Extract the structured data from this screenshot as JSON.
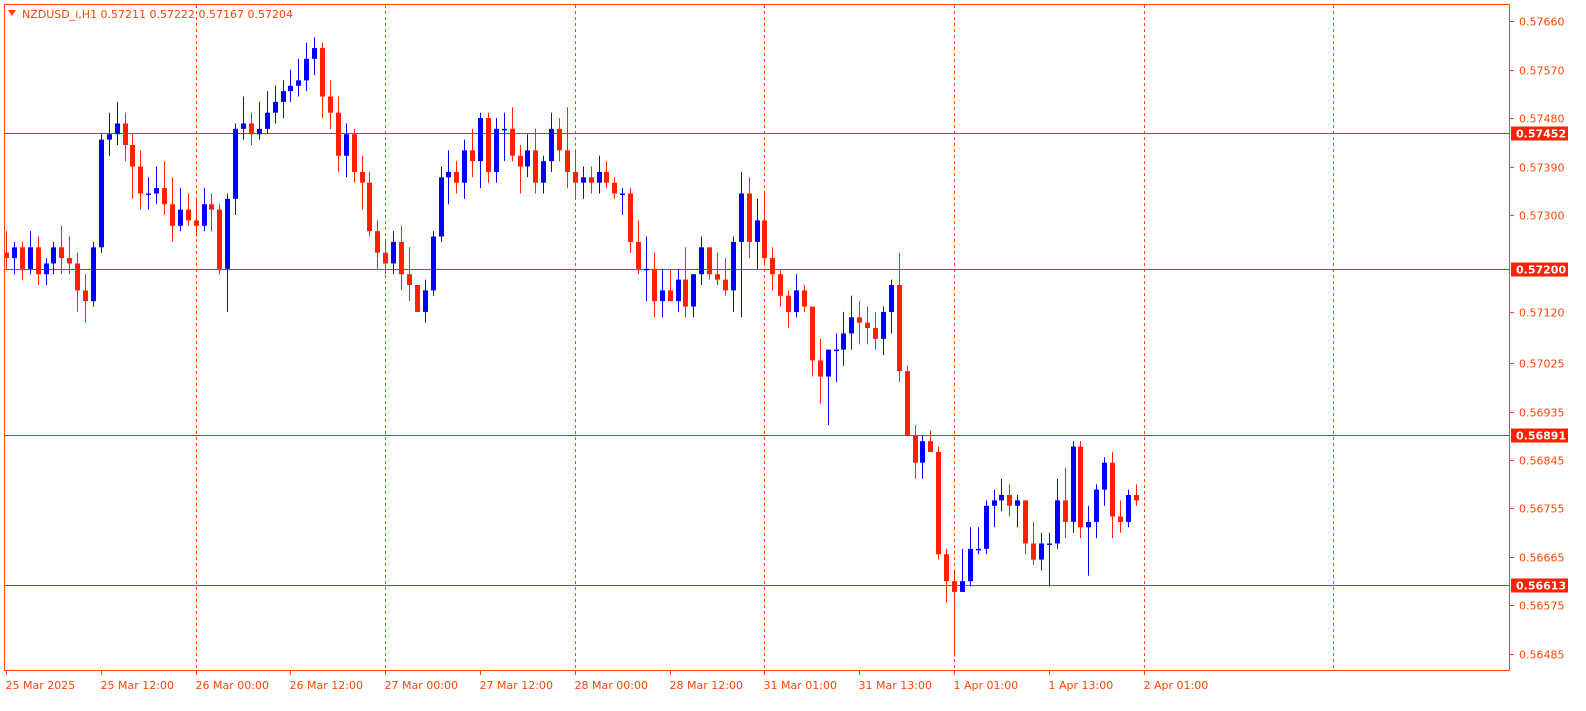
{
  "symbol_header": {
    "text": "NZDUSD_i,H1  0.57211  0.57222  0.57167  0.57204",
    "indicator_icon": "triangle-down-icon"
  },
  "colors": {
    "background": "#ffffff",
    "frame": "#ff4500",
    "grid": "#ff4500",
    "text": "#ff4500",
    "bull": "#0000ff",
    "bear": "#ff2000",
    "level_line": "#ff2000",
    "level_tag_bg": "#ff2000",
    "level_tag_text": "#ffffff"
  },
  "chart_data": {
    "type": "candlestick",
    "symbol": "NZDUSD_i",
    "timeframe": "H1",
    "last_bar": {
      "open": 0.57211,
      "high": 0.57222,
      "low": 0.57167,
      "close": 0.57204
    },
    "ylim": [
      0.56455,
      0.5769
    ],
    "price_ticks": [
      0.5766,
      0.5757,
      0.5748,
      0.5739,
      0.573,
      0.5712,
      0.57025,
      0.56935,
      0.56845,
      0.56755,
      0.56665,
      0.56575,
      0.56485
    ],
    "price_tick_labels": [
      "0.57660",
      "0.57570",
      "0.57480",
      "0.57390",
      "0.57300",
      "0.57120",
      "0.57025",
      "0.56935",
      "0.56845",
      "0.56755",
      "0.56665",
      "0.56575",
      "0.56485"
    ],
    "horizontal_levels": [
      {
        "price": 0.57452,
        "label": "0.57452"
      },
      {
        "price": 0.572,
        "label": "0.57200"
      },
      {
        "price": 0.56891,
        "label": "0.56891"
      },
      {
        "price": 0.56613,
        "label": "0.56613"
      }
    ],
    "time_labels": [
      "25 Mar 2025",
      "25 Mar 12:00",
      "26 Mar 00:00",
      "26 Mar 12:00",
      "27 Mar 00:00",
      "27 Mar 12:00",
      "28 Mar 00:00",
      "28 Mar 12:00",
      "31 Mar 01:00",
      "31 Mar 13:00",
      "1 Apr 01:00",
      "1 Apr 13:00",
      "2 Apr 01:00"
    ],
    "time_label_bar_index": [
      0,
      12,
      24,
      36,
      48,
      60,
      72,
      84,
      96,
      108,
      120,
      132,
      144
    ],
    "vertical_grid_bar_index": [
      24,
      48,
      72,
      96,
      120,
      144,
      168
    ],
    "grid": "vertical dotted",
    "ohlc": [
      [
        0.5723,
        0.5727,
        0.572,
        0.5722
      ],
      [
        0.5722,
        0.5725,
        0.5719,
        0.5724
      ],
      [
        0.5724,
        0.5725,
        0.5718,
        0.572
      ],
      [
        0.572,
        0.5727,
        0.5719,
        0.5724
      ],
      [
        0.5724,
        0.5726,
        0.5717,
        0.5719
      ],
      [
        0.5719,
        0.5722,
        0.5717,
        0.5721
      ],
      [
        0.5721,
        0.5725,
        0.5719,
        0.5724
      ],
      [
        0.5724,
        0.5728,
        0.5719,
        0.5722
      ],
      [
        0.5722,
        0.5726,
        0.5719,
        0.5721
      ],
      [
        0.5721,
        0.5723,
        0.5712,
        0.5716
      ],
      [
        0.5716,
        0.5719,
        0.571,
        0.5714
      ],
      [
        0.5714,
        0.5725,
        0.5713,
        0.5724
      ],
      [
        0.5724,
        0.5745,
        0.5723,
        0.5744
      ],
      [
        0.5744,
        0.5749,
        0.5741,
        0.5745
      ],
      [
        0.5745,
        0.5751,
        0.5743,
        0.5747
      ],
      [
        0.5747,
        0.5749,
        0.574,
        0.5743
      ],
      [
        0.5743,
        0.5745,
        0.5733,
        0.5739
      ],
      [
        0.5739,
        0.5742,
        0.5731,
        0.5734
      ],
      [
        0.5734,
        0.5737,
        0.5731,
        0.5734
      ],
      [
        0.5734,
        0.5739,
        0.5732,
        0.5735
      ],
      [
        0.5735,
        0.574,
        0.573,
        0.5732
      ],
      [
        0.5732,
        0.5737,
        0.5725,
        0.5728
      ],
      [
        0.5728,
        0.5735,
        0.5727,
        0.5731
      ],
      [
        0.5731,
        0.5734,
        0.5728,
        0.5729
      ],
      [
        0.5729,
        0.5733,
        0.5726,
        0.5728
      ],
      [
        0.5728,
        0.5735,
        0.5727,
        0.5732
      ],
      [
        0.5732,
        0.5734,
        0.5727,
        0.5731
      ],
      [
        0.5731,
        0.5732,
        0.5719,
        0.572
      ],
      [
        0.572,
        0.5734,
        0.5712,
        0.5733
      ],
      [
        0.5733,
        0.5747,
        0.573,
        0.5746
      ],
      [
        0.5746,
        0.5752,
        0.5744,
        0.5747
      ],
      [
        0.5747,
        0.5749,
        0.5743,
        0.5745
      ],
      [
        0.5745,
        0.5751,
        0.5744,
        0.5746
      ],
      [
        0.5746,
        0.5753,
        0.5745,
        0.5749
      ],
      [
        0.5749,
        0.5754,
        0.5747,
        0.5751
      ],
      [
        0.5751,
        0.5755,
        0.5748,
        0.5753
      ],
      [
        0.5753,
        0.5757,
        0.5751,
        0.5754
      ],
      [
        0.5754,
        0.5759,
        0.5752,
        0.5755
      ],
      [
        0.5755,
        0.5762,
        0.5753,
        0.5759
      ],
      [
        0.5759,
        0.5763,
        0.5756,
        0.5761
      ],
      [
        0.5761,
        0.5762,
        0.5748,
        0.5752
      ],
      [
        0.5752,
        0.5755,
        0.5746,
        0.5749
      ],
      [
        0.5749,
        0.5752,
        0.5738,
        0.5741
      ],
      [
        0.5741,
        0.5747,
        0.5737,
        0.5745
      ],
      [
        0.5745,
        0.5746,
        0.5736,
        0.5738
      ],
      [
        0.5738,
        0.5741,
        0.5731,
        0.5736
      ],
      [
        0.5736,
        0.5738,
        0.5726,
        0.5727
      ],
      [
        0.5727,
        0.5729,
        0.572,
        0.5723
      ],
      [
        0.5723,
        0.5725,
        0.5719,
        0.5721
      ],
      [
        0.5721,
        0.5727,
        0.5719,
        0.5725
      ],
      [
        0.5725,
        0.5728,
        0.5716,
        0.5719
      ],
      [
        0.5719,
        0.5724,
        0.5714,
        0.5717
      ],
      [
        0.5717,
        0.5715,
        0.5712,
        0.5712
      ],
      [
        0.5712,
        0.5718,
        0.571,
        0.5716
      ],
      [
        0.5716,
        0.5727,
        0.5715,
        0.5726
      ],
      [
        0.5726,
        0.5739,
        0.5725,
        0.5737
      ],
      [
        0.5737,
        0.5742,
        0.5732,
        0.5738
      ],
      [
        0.5738,
        0.574,
        0.5734,
        0.5736
      ],
      [
        0.5736,
        0.5744,
        0.5733,
        0.5742
      ],
      [
        0.5742,
        0.5746,
        0.5737,
        0.574
      ],
      [
        0.574,
        0.5749,
        0.5735,
        0.5748
      ],
      [
        0.5748,
        0.5749,
        0.5736,
        0.5738
      ],
      [
        0.5738,
        0.5748,
        0.5736,
        0.5746
      ],
      [
        0.5746,
        0.5749,
        0.574,
        0.5746
      ],
      [
        0.5746,
        0.575,
        0.574,
        0.5741
      ],
      [
        0.5741,
        0.5743,
        0.5734,
        0.5739
      ],
      [
        0.5739,
        0.5745,
        0.5737,
        0.5742
      ],
      [
        0.5742,
        0.5746,
        0.5734,
        0.5736
      ],
      [
        0.5736,
        0.5741,
        0.5734,
        0.574
      ],
      [
        0.574,
        0.5749,
        0.5738,
        0.5746
      ],
      [
        0.5746,
        0.5748,
        0.574,
        0.5742
      ],
      [
        0.5742,
        0.575,
        0.5735,
        0.5738
      ],
      [
        0.5738,
        0.5742,
        0.5733,
        0.5736
      ],
      [
        0.5736,
        0.5739,
        0.5733,
        0.5737
      ],
      [
        0.5737,
        0.5739,
        0.5734,
        0.5736
      ],
      [
        0.5736,
        0.5741,
        0.5734,
        0.5738
      ],
      [
        0.5738,
        0.574,
        0.5735,
        0.5736
      ],
      [
        0.5736,
        0.5737,
        0.5733,
        0.5734
      ],
      [
        0.5734,
        0.5735,
        0.573,
        0.5734
      ],
      [
        0.5734,
        0.5735,
        0.5723,
        0.5725
      ],
      [
        0.5725,
        0.5729,
        0.5719,
        0.572
      ],
      [
        0.572,
        0.5726,
        0.5714,
        0.572
      ],
      [
        0.572,
        0.5723,
        0.5711,
        0.5714
      ],
      [
        0.5714,
        0.572,
        0.5711,
        0.5716
      ],
      [
        0.5716,
        0.572,
        0.5714,
        0.5714
      ],
      [
        0.5714,
        0.572,
        0.5712,
        0.5718
      ],
      [
        0.5718,
        0.5724,
        0.5711,
        0.5713
      ],
      [
        0.5713,
        0.5719,
        0.5711,
        0.5719
      ],
      [
        0.5719,
        0.5726,
        0.5717,
        0.5724
      ],
      [
        0.5724,
        0.5723,
        0.5718,
        0.5719
      ],
      [
        0.5719,
        0.5723,
        0.5717,
        0.5718
      ],
      [
        0.5718,
        0.5722,
        0.5715,
        0.5716
      ],
      [
        0.5716,
        0.5726,
        0.5712,
        0.5725
      ],
      [
        0.5725,
        0.5738,
        0.5711,
        0.5734
      ],
      [
        0.5734,
        0.5737,
        0.5722,
        0.5725
      ],
      [
        0.5725,
        0.5733,
        0.572,
        0.5729
      ],
      [
        0.5729,
        0.5734,
        0.5721,
        0.5722
      ],
      [
        0.5722,
        0.5724,
        0.5716,
        0.5719
      ],
      [
        0.5719,
        0.572,
        0.5713,
        0.5715
      ],
      [
        0.5715,
        0.5716,
        0.5709,
        0.5712
      ],
      [
        0.5712,
        0.5719,
        0.5711,
        0.5716
      ],
      [
        0.5716,
        0.5717,
        0.5712,
        0.5713
      ],
      [
        0.5713,
        0.5708,
        0.57,
        0.5703
      ],
      [
        0.5703,
        0.5707,
        0.5695,
        0.57
      ],
      [
        0.57,
        0.5705,
        0.5691,
        0.5705
      ],
      [
        0.5705,
        0.5708,
        0.5699,
        0.5705
      ],
      [
        0.5705,
        0.5712,
        0.5702,
        0.5708
      ],
      [
        0.5708,
        0.5715,
        0.5705,
        0.5711
      ],
      [
        0.5711,
        0.5714,
        0.5706,
        0.571
      ],
      [
        0.571,
        0.5713,
        0.5706,
        0.5709
      ],
      [
        0.5709,
        0.5712,
        0.5705,
        0.5707
      ],
      [
        0.5707,
        0.5713,
        0.5704,
        0.5712
      ],
      [
        0.5712,
        0.5718,
        0.5708,
        0.5717
      ],
      [
        0.5717,
        0.5723,
        0.5699,
        0.5701
      ],
      [
        0.5701,
        0.5702,
        0.5689,
        0.5689
      ],
      [
        0.5689,
        0.5691,
        0.5681,
        0.5684
      ],
      [
        0.5684,
        0.5689,
        0.5681,
        0.5688
      ],
      [
        0.5688,
        0.569,
        0.5686,
        0.5686
      ],
      [
        0.5686,
        0.5687,
        0.5666,
        0.5667
      ],
      [
        0.5667,
        0.5668,
        0.5658,
        0.5662
      ],
      [
        0.5662,
        0.5664,
        0.5648,
        0.566
      ],
      [
        0.566,
        0.5668,
        0.566,
        0.5662
      ],
      [
        0.5662,
        0.5672,
        0.5661,
        0.5668
      ],
      [
        0.5668,
        0.5672,
        0.5667,
        0.5668
      ],
      [
        0.5668,
        0.5677,
        0.5667,
        0.5676
      ],
      [
        0.5676,
        0.5679,
        0.5672,
        0.5677
      ],
      [
        0.5677,
        0.5681,
        0.5675,
        0.5678
      ],
      [
        0.5678,
        0.568,
        0.5674,
        0.5676
      ],
      [
        0.5676,
        0.5678,
        0.5672,
        0.5677
      ],
      [
        0.5677,
        0.5677,
        0.5667,
        0.5669
      ],
      [
        0.5669,
        0.5673,
        0.5665,
        0.5666
      ],
      [
        0.5666,
        0.5671,
        0.5664,
        0.5669
      ],
      [
        0.5669,
        0.5671,
        0.5661,
        0.5669
      ],
      [
        0.5669,
        0.5681,
        0.5668,
        0.5677
      ],
      [
        0.5677,
        0.5683,
        0.567,
        0.5673
      ],
      [
        0.5673,
        0.5688,
        0.5671,
        0.5687
      ],
      [
        0.5687,
        0.5688,
        0.567,
        0.5672
      ],
      [
        0.5672,
        0.5676,
        0.5663,
        0.5673
      ],
      [
        0.5673,
        0.568,
        0.567,
        0.5679
      ],
      [
        0.5679,
        0.5685,
        0.5676,
        0.5684
      ],
      [
        0.5684,
        0.5686,
        0.567,
        0.5674
      ],
      [
        0.5674,
        0.5677,
        0.5671,
        0.5673
      ],
      [
        0.5673,
        0.5679,
        0.5672,
        0.5678
      ],
      [
        0.5678,
        0.568,
        0.5676,
        0.5677
      ]
    ]
  }
}
